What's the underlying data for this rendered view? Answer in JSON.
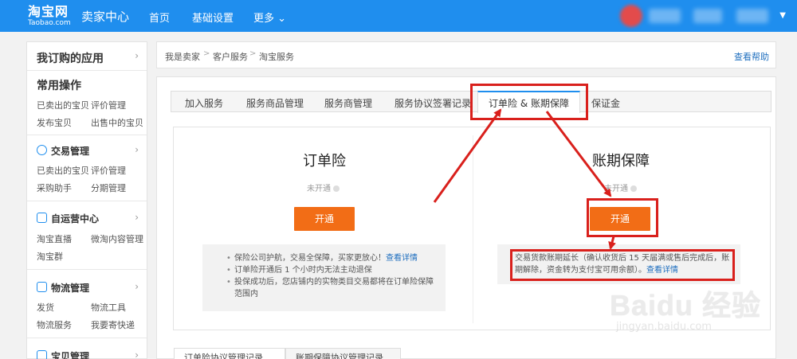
{
  "header": {
    "logo_cn": "淘宝网",
    "logo_en": "Taobao.com",
    "seller_center": "卖家中心",
    "nav": [
      "首页",
      "基础设置",
      "更多 ⌄"
    ]
  },
  "sidebar": {
    "my_apps": "我订购的应用",
    "common_ops": "常用操作",
    "common_links": [
      "已卖出的宝贝",
      "评价管理",
      "发布宝贝",
      "出售中的宝贝"
    ],
    "groups": [
      {
        "title": "交易管理",
        "links": [
          "已卖出的宝贝",
          "评价管理",
          "采购助手",
          "分期管理"
        ]
      },
      {
        "title": "自运营中心",
        "links": [
          "淘宝直播",
          "微淘内容管理",
          "淘宝群"
        ]
      },
      {
        "title": "物流管理",
        "links": [
          "发货",
          "物流工具",
          "物流服务",
          "我要寄快递"
        ]
      },
      {
        "title": "宝贝管理",
        "links": []
      }
    ]
  },
  "breadcrumb": {
    "items": [
      "我是卖家",
      "客户服务",
      "淘宝服务"
    ],
    "help": "查看帮助"
  },
  "tabs": [
    "加入服务",
    "服务商品管理",
    "服务商管理",
    "服务协议签署记录",
    "订单险 & 账期保障",
    "保证金"
  ],
  "services": {
    "left": {
      "title": "订单险",
      "status": "未开通",
      "button": "开通",
      "info": [
        {
          "text": "保险公司护航，交易全保障，买家更放心！",
          "link": "查看详情"
        },
        {
          "text": "订单险开通后 1 个小时内无法主动退保"
        },
        {
          "text": "投保成功后，您店铺内的实物类目交易都将在订单险保障范围内"
        }
      ]
    },
    "right": {
      "title": "账期保障",
      "status": "未开通",
      "button": "开通",
      "info_text": "交易货款账期延长（确认收货后 15 天届满或售后完成后，账期解除，资金转为支付宝可用余额）。",
      "info_link": "查看详情"
    }
  },
  "bottom_tabs": [
    "订单险协议管理记录",
    "账期保障协议管理记录"
  ],
  "watermark": {
    "main": "Baidu 经验",
    "sub": "jingyan.baidu.com"
  },
  "colors": {
    "topbar": "#1f8eee",
    "button": "#f26d16",
    "annotation": "#d9201c",
    "link": "#1f6fbf"
  }
}
